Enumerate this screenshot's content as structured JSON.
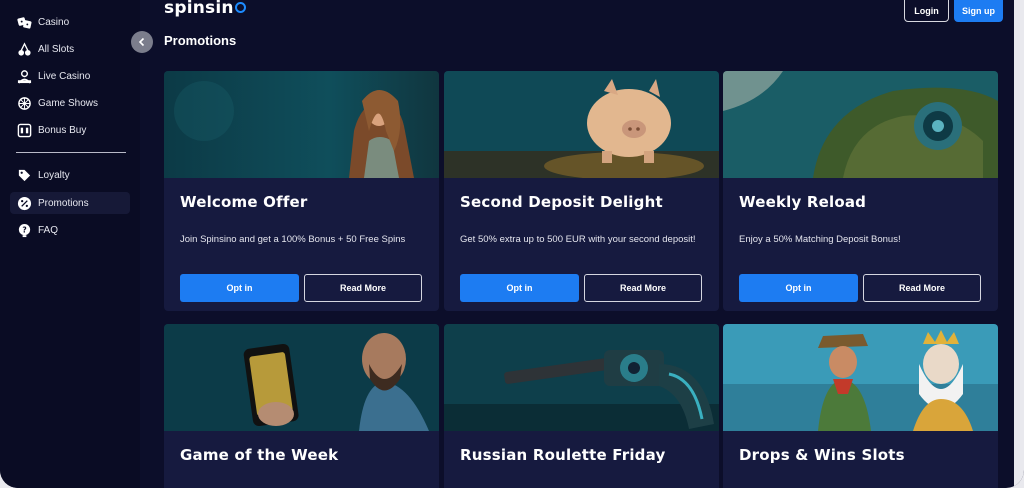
{
  "brand": {
    "logo_text": "spinsin"
  },
  "header": {
    "login_label": "Login",
    "signup_label": "Sign up"
  },
  "page": {
    "title": "Promotions"
  },
  "sidebar": {
    "items": [
      {
        "label": "Casino",
        "icon": "dice-icon"
      },
      {
        "label": "All Slots",
        "icon": "cherries-icon"
      },
      {
        "label": "Live Casino",
        "icon": "dealer-icon"
      },
      {
        "label": "Game Shows",
        "icon": "wheel-icon"
      },
      {
        "label": "Bonus Buy",
        "icon": "slot-machine-icon"
      }
    ],
    "items2": [
      {
        "label": "Loyalty",
        "icon": "tag-icon"
      },
      {
        "label": "Promotions",
        "icon": "percent-icon",
        "active": true
      },
      {
        "label": "FAQ",
        "icon": "help-icon"
      }
    ]
  },
  "promotions": [
    {
      "title": "Welcome Offer",
      "description": "Join Spinsino and get a 100% Bonus + 50 Free Spins",
      "opt_in": "Opt in",
      "read_more": "Read More"
    },
    {
      "title": "Second Deposit Delight",
      "description": "Get 50% extra up to 500 EUR with your second deposit!",
      "opt_in": "Opt in",
      "read_more": "Read More"
    },
    {
      "title": "Weekly Reload",
      "description": "Enjoy a 50% Matching Deposit Bonus!",
      "opt_in": "Opt in",
      "read_more": "Read More"
    },
    {
      "title": "Game of the Week"
    },
    {
      "title": "Russian Roulette Friday"
    },
    {
      "title": "Drops & Wins Slots"
    }
  ],
  "colors": {
    "accent": "#1d7cf2",
    "background": "#0c0e2a",
    "card": "#161a3f",
    "sidebar": "#0a0c24"
  }
}
